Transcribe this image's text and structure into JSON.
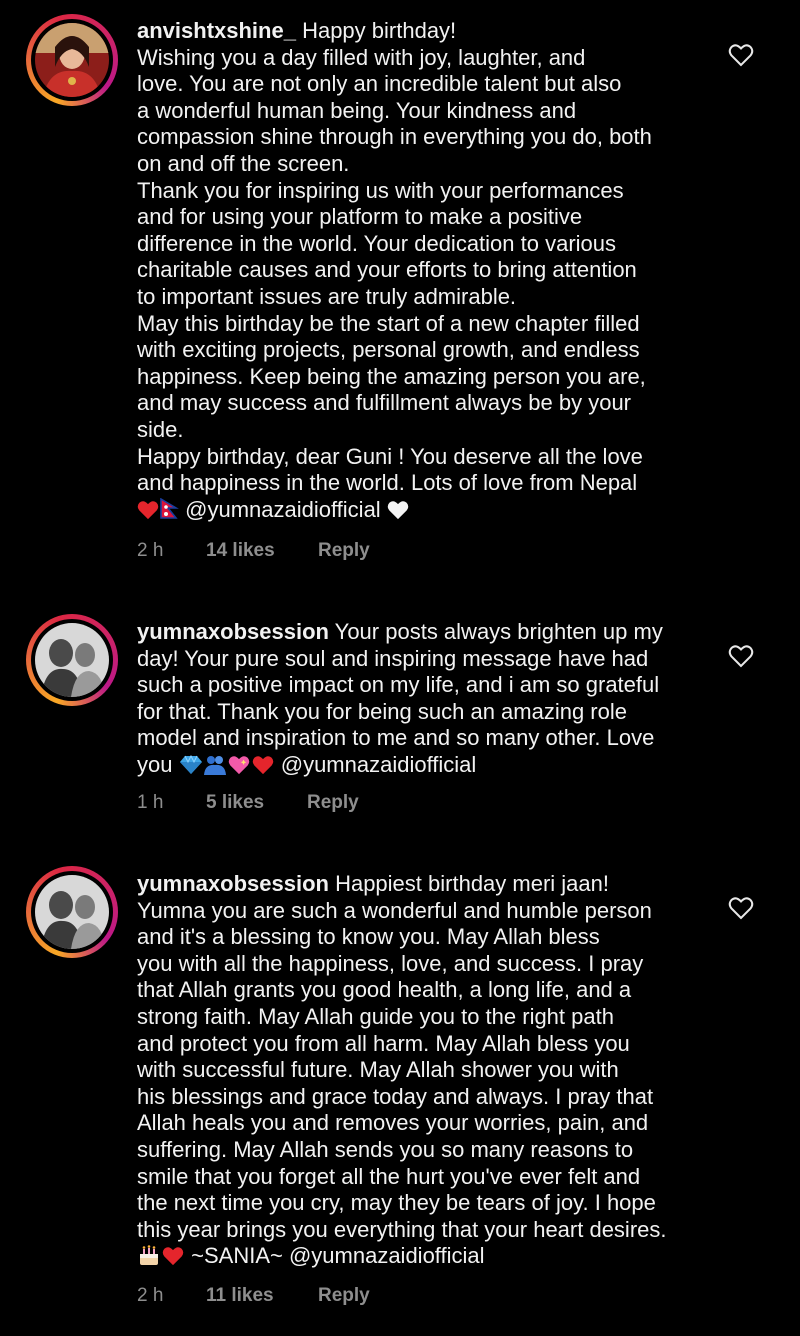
{
  "comments": [
    {
      "username": "anvishtxshine_",
      "lines": [
        "Happy birthday!",
        "Wishing you a day filled with joy, laughter, and",
        "love. You are not only an incredible talent but also",
        "a wonderful human being. Your kindness and",
        "compassion shine through in everything you do, both",
        "on and off the screen.",
        "Thank you for inspiring us with your performances",
        "and for using your platform to make a positive",
        "difference in the world. Your dedication to various",
        "charitable causes and your efforts to bring attention",
        "to important issues are truly admirable.",
        "May this birthday be the start of a new chapter filled",
        "with exciting projects, personal growth, and endless",
        "happiness. Keep being the amazing person you are,",
        "and may success and fulfillment always be by your",
        "side.",
        "Happy birthday, dear Guni ! You deserve all the love",
        "and happiness in the world. Lots of love from Nepal"
      ],
      "last_line_text": "@yumnazaidiofficial",
      "time": "2 h",
      "likes": "14 likes",
      "reply": "Reply"
    },
    {
      "username": "yumnaxobsession",
      "lines": [
        "Your posts always brighten up my",
        "day! Your pure soul and inspiring message have had",
        "such a positive impact on my life, and i am so grateful",
        "for that. Thank you for being such an amazing role",
        "model and inspiration to me and so many other. Love"
      ],
      "last_line_prefix": "you",
      "last_line_text": "@yumnazaidiofficial",
      "time": "1 h",
      "likes": "5 likes",
      "reply": "Reply"
    },
    {
      "username": "yumnaxobsession",
      "lines": [
        "Happiest birthday meri jaan!",
        "Yumna you are such a wonderful and humble person",
        "and it's a blessing to know you. May Allah bless",
        "you with all the happiness, love, and success. I pray",
        "that Allah grants you good health, a long life, and a",
        "strong faith. May Allah guide you to the right path",
        "and protect you from all harm. May Allah bless you",
        "with successful future. May Allah shower you with",
        "his blessings and grace today and always. I pray that",
        "Allah heals you and removes your worries, pain, and",
        "suffering. May Allah sends you so many reasons to",
        "smile that you forget all the hurt you've ever felt and",
        "the next time you cry, may they be tears of joy. I hope",
        "this year brings you everything that your heart desires."
      ],
      "last_line_text": "~SANIA~ @yumnazaidiofficial",
      "time": "2 h",
      "likes": "11 likes",
      "reply": "Reply"
    }
  ],
  "icons": {
    "like": "heart-outline-icon",
    "heart_red": "red-heart-emoji",
    "heart_white": "white-heart-emoji",
    "flag": "nepal-flag-emoji",
    "diamond": "blue-diamond-emoji",
    "hug": "people-hugging-emoji",
    "heart_sparkle": "sparkling-heart-emoji",
    "cake": "birthday-cake-emoji"
  },
  "colors": {
    "background": "#000000",
    "text": "#f2f2f2",
    "meta": "#8e8e8e",
    "heart_red": "#e5252c"
  }
}
